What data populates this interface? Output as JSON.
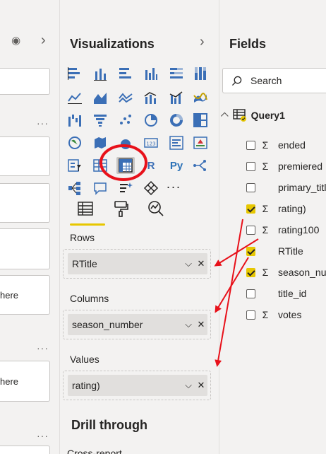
{
  "filters": {
    "f_items": [
      {
        "text": ""
      },
      {
        "text": ""
      },
      {
        "text": ""
      },
      {
        "text": "here"
      },
      {
        "text": ""
      },
      {
        "text": "here"
      }
    ]
  },
  "viz": {
    "title": "Visualizations",
    "python_label": "Py",
    "r_label": "R",
    "more_label": "···",
    "wells": [
      {
        "label": "Rows",
        "field": "RTitle"
      },
      {
        "label": "Columns",
        "field": "season_number"
      },
      {
        "label": "Values",
        "field": "rating)"
      }
    ],
    "drill_title": "Drill through",
    "cross_report": "Cross-report"
  },
  "fields": {
    "title": "Fields",
    "search_placeholder": "Search",
    "table_name": "Query1",
    "items": [
      {
        "name": "ended",
        "checked": false,
        "sigma": true
      },
      {
        "name": "premiered",
        "checked": false,
        "sigma": true
      },
      {
        "name": "primary_title",
        "checked": false,
        "sigma": false
      },
      {
        "name": "rating)",
        "checked": true,
        "sigma": true
      },
      {
        "name": "rating100",
        "checked": false,
        "sigma": true
      },
      {
        "name": "RTitle",
        "checked": true,
        "sigma": false
      },
      {
        "name": "season_number",
        "checked": true,
        "sigma": true
      },
      {
        "name": "title_id",
        "checked": false,
        "sigma": false
      },
      {
        "name": "votes",
        "checked": false,
        "sigma": true
      }
    ]
  },
  "colors": {
    "accent_yellow": "#e7c700",
    "annotation_red": "#e8111a",
    "viz_blue": "#3b6fb6"
  }
}
